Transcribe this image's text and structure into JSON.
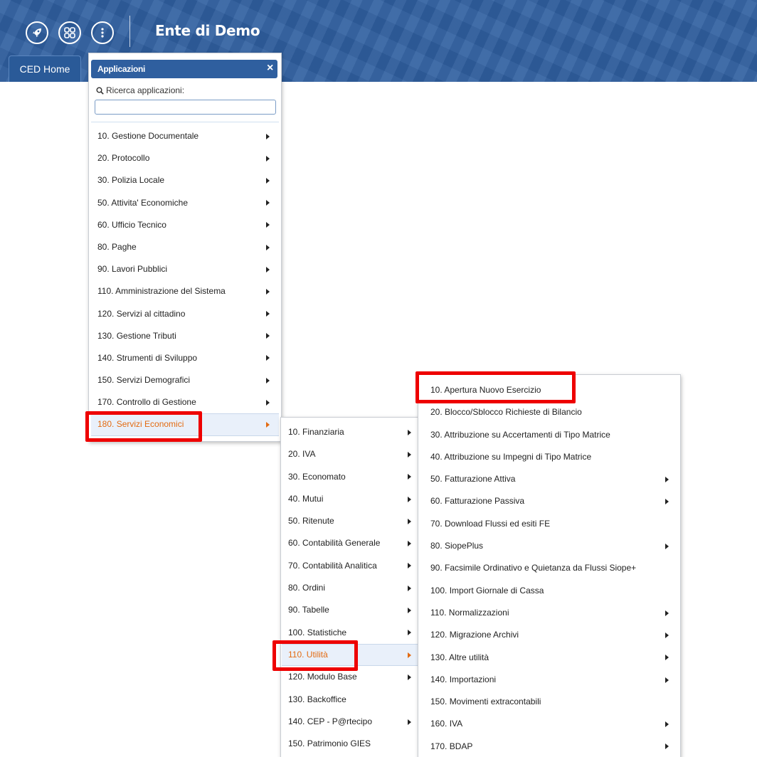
{
  "header": {
    "title": "Ente di Demo",
    "icons": [
      "rocket-icon",
      "apps-grid-icon",
      "more-vertical-icon"
    ]
  },
  "tabs": [
    "CED Home"
  ],
  "apps_panel": {
    "title": "Applicazioni",
    "close_label": "×",
    "search_label": "Ricerca applicazioni:",
    "search_value": "",
    "items": [
      {
        "label": "10. Gestione Documentale",
        "has_submenu": true
      },
      {
        "label": "20. Protocollo",
        "has_submenu": true
      },
      {
        "label": "30. Polizia Locale",
        "has_submenu": true
      },
      {
        "label": "50. Attivita' Economiche",
        "has_submenu": true
      },
      {
        "label": "60. Ufficio Tecnico",
        "has_submenu": true
      },
      {
        "label": "80. Paghe",
        "has_submenu": true
      },
      {
        "label": "90. Lavori Pubblici",
        "has_submenu": true
      },
      {
        "label": "110. Amministrazione del Sistema",
        "has_submenu": true
      },
      {
        "label": "120. Servizi al cittadino",
        "has_submenu": true
      },
      {
        "label": "130. Gestione Tributi",
        "has_submenu": true
      },
      {
        "label": "140. Strumenti di Sviluppo",
        "has_submenu": true
      },
      {
        "label": "150. Servizi Demografici",
        "has_submenu": true
      },
      {
        "label": "170. Controllo di Gestione",
        "has_submenu": true
      },
      {
        "label": "180. Servizi Economici",
        "has_submenu": true,
        "active": true,
        "highlighted": true
      }
    ]
  },
  "servizi_economici_menu": {
    "items": [
      {
        "label": "10. Finanziaria",
        "has_submenu": true
      },
      {
        "label": "20. IVA",
        "has_submenu": true
      },
      {
        "label": "30. Economato",
        "has_submenu": true
      },
      {
        "label": "40. Mutui",
        "has_submenu": true
      },
      {
        "label": "50. Ritenute",
        "has_submenu": true
      },
      {
        "label": "60. Contabilità Generale",
        "has_submenu": true
      },
      {
        "label": "70. Contabilità Analitica",
        "has_submenu": true
      },
      {
        "label": "80. Ordini",
        "has_submenu": true
      },
      {
        "label": "90. Tabelle",
        "has_submenu": true
      },
      {
        "label": "100. Statistiche",
        "has_submenu": true
      },
      {
        "label": "110. Utilità",
        "has_submenu": true,
        "active": true,
        "highlighted": true
      },
      {
        "label": "120. Modulo Base",
        "has_submenu": true
      },
      {
        "label": "130. Backoffice",
        "has_submenu": false
      },
      {
        "label": "140. CEP - P@rtecipo",
        "has_submenu": true
      },
      {
        "label": "150. Patrimonio GIES",
        "has_submenu": false
      }
    ]
  },
  "utilita_menu": {
    "items": [
      {
        "label": "10. Apertura Nuovo Esercizio",
        "has_submenu": false,
        "highlighted": true
      },
      {
        "label": "20. Blocco/Sblocco Richieste di Bilancio",
        "has_submenu": false
      },
      {
        "label": "30. Attribuzione su Accertamenti di Tipo Matrice",
        "has_submenu": false
      },
      {
        "label": "40. Attribuzione su Impegni di Tipo Matrice",
        "has_submenu": false
      },
      {
        "label": "50. Fatturazione Attiva",
        "has_submenu": true
      },
      {
        "label": "60. Fatturazione Passiva",
        "has_submenu": true
      },
      {
        "label": "70. Download Flussi ed esiti FE",
        "has_submenu": false
      },
      {
        "label": "80. SiopePlus",
        "has_submenu": true
      },
      {
        "label": "90. Facsimile Ordinativo e Quietanza da Flussi Siope+",
        "has_submenu": false
      },
      {
        "label": "100. Import Giornale di Cassa",
        "has_submenu": false
      },
      {
        "label": "110. Normalizzazioni",
        "has_submenu": true
      },
      {
        "label": "120. Migrazione Archivi",
        "has_submenu": true
      },
      {
        "label": "130. Altre utilità",
        "has_submenu": true
      },
      {
        "label": "140. Importazioni",
        "has_submenu": true
      },
      {
        "label": "150. Movimenti extracontabili",
        "has_submenu": false
      },
      {
        "label": "160. IVA",
        "has_submenu": true
      },
      {
        "label": "170. BDAP",
        "has_submenu": true
      }
    ]
  },
  "colors": {
    "header_bg": "#2f5f9f",
    "active_item": "#e36b12",
    "highlight_box": "#ee0000"
  }
}
